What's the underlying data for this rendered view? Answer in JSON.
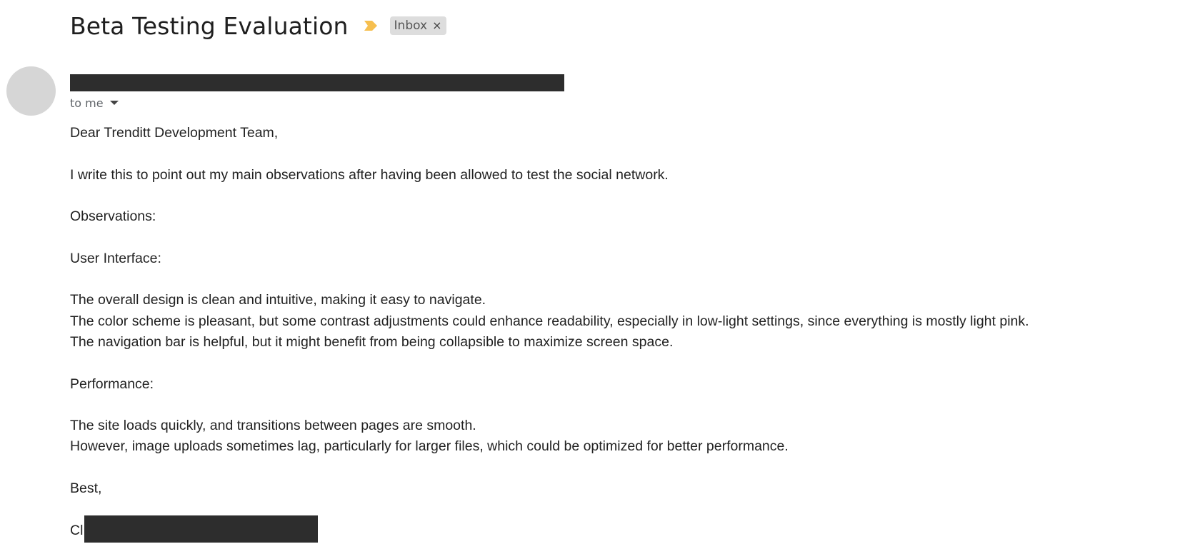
{
  "email": {
    "subject": "Beta Testing Evaluation",
    "label": "Inbox",
    "label_remove": "×",
    "recipient": "to me",
    "colors": {
      "importance_marker": "#f6bf4f",
      "redaction": "#2d2d2d",
      "avatar": "#d6d6d6",
      "chip": "#dddddd"
    },
    "body": {
      "greeting": "Dear Trenditt Development Team,",
      "intro": "I write this to point out my main observations after having been allowed to test  the social network.",
      "observations_heading": "Observations:",
      "ui_heading": "User Interface:",
      "ui_points": [
        "The overall design is clean and intuitive, making it easy to navigate.",
        "The color scheme is pleasant, but some contrast adjustments could enhance readability, especially in low-light settings, since everything is mostly light pink.",
        "The navigation bar is helpful, but it might benefit from being collapsible to maximize screen space."
      ],
      "performance_heading": "Performance:",
      "performance_points": [
        "The site loads quickly, and transitions between pages are smooth.",
        "However, image uploads sometimes lag, particularly for larger files, which could be optimized for better performance."
      ],
      "closing": "Best,",
      "signature_visible": "Cl"
    }
  }
}
